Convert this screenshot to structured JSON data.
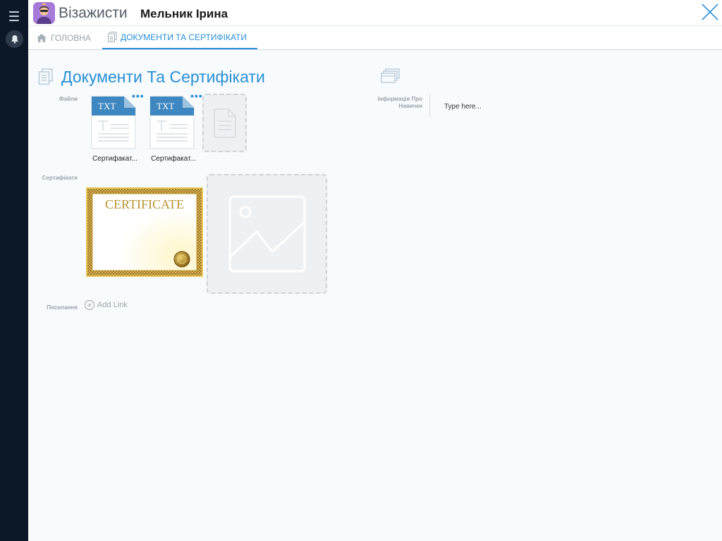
{
  "header": {
    "app_title": "Візажисти",
    "record_title": "Мельник Ірина"
  },
  "tabs": [
    {
      "label": "ГОЛОВНА",
      "icon": "home-icon",
      "active": false
    },
    {
      "label": "ДОКУМЕНТИ ТА СЕРТИФІКАТИ",
      "icon": "document-icon",
      "active": true
    }
  ],
  "section": {
    "title": "Документи Та Сертифікати"
  },
  "fields": {
    "files_label": "Файли",
    "certificates_label": "Сертифікати",
    "links_label": "Посилання",
    "skills_label": "Інформація Про Навички"
  },
  "files": [
    {
      "type": "TXT",
      "name": "Сертифакат..."
    },
    {
      "type": "TXT",
      "name": "Сертифакат..."
    }
  ],
  "certificate": {
    "title": "CERTIFICATE"
  },
  "links": {
    "add_label": "Add Link"
  },
  "skills_input": {
    "placeholder": "Type here..."
  },
  "colors": {
    "accent": "#2a8fd6",
    "rail": "#0c1828",
    "placeholder_bg": "#eef1f4"
  }
}
